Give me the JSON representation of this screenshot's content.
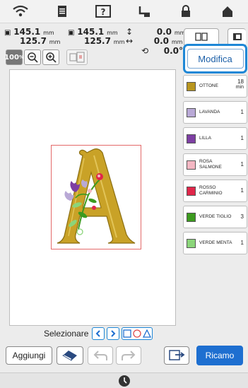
{
  "info": {
    "size_w": "145.1",
    "size_h": "125.7",
    "area_w": "145.1",
    "area_h": "125.7",
    "unit": "mm",
    "offset_v": "0.0",
    "offset_h": "0.0",
    "rotation": "0.0°",
    "zoom": "100"
  },
  "actions": {
    "edit_label": "Modifica",
    "select_label": "Selezionare",
    "add_label": "Aggiungi",
    "embroider_label": "Ricamo"
  },
  "threads": [
    {
      "name": "OTTONE",
      "value": "18",
      "value2": "min",
      "color": "#b8951e"
    },
    {
      "name": "LAVANDA",
      "value": "1",
      "value2": "",
      "color": "#b9a9d6"
    },
    {
      "name": "LILLA",
      "value": "1",
      "value2": "",
      "color": "#7d3fa3"
    },
    {
      "name": "ROSA",
      "name2": "SALMONE",
      "value": "1",
      "value2": "",
      "color": "#f4b7c3"
    },
    {
      "name": "ROSSO",
      "name2": "CARMINIO",
      "value": "1",
      "value2": "",
      "color": "#e0264a"
    },
    {
      "name": "VERDE TIGLIO",
      "value": "3",
      "value2": "",
      "color": "#3c9a1f"
    },
    {
      "name": "VERDE MENTA",
      "value": "1",
      "value2": "",
      "color": "#8bd57a"
    }
  ],
  "icons": [
    "wifi-icon",
    "document-icon",
    "help-icon",
    "thread-icon",
    "lock-icon",
    "home-icon",
    "zoom-out-icon",
    "zoom-in-icon",
    "preview-icon",
    "undo-icon",
    "redo-icon",
    "eraser-icon",
    "send-icon",
    "clock-icon"
  ]
}
